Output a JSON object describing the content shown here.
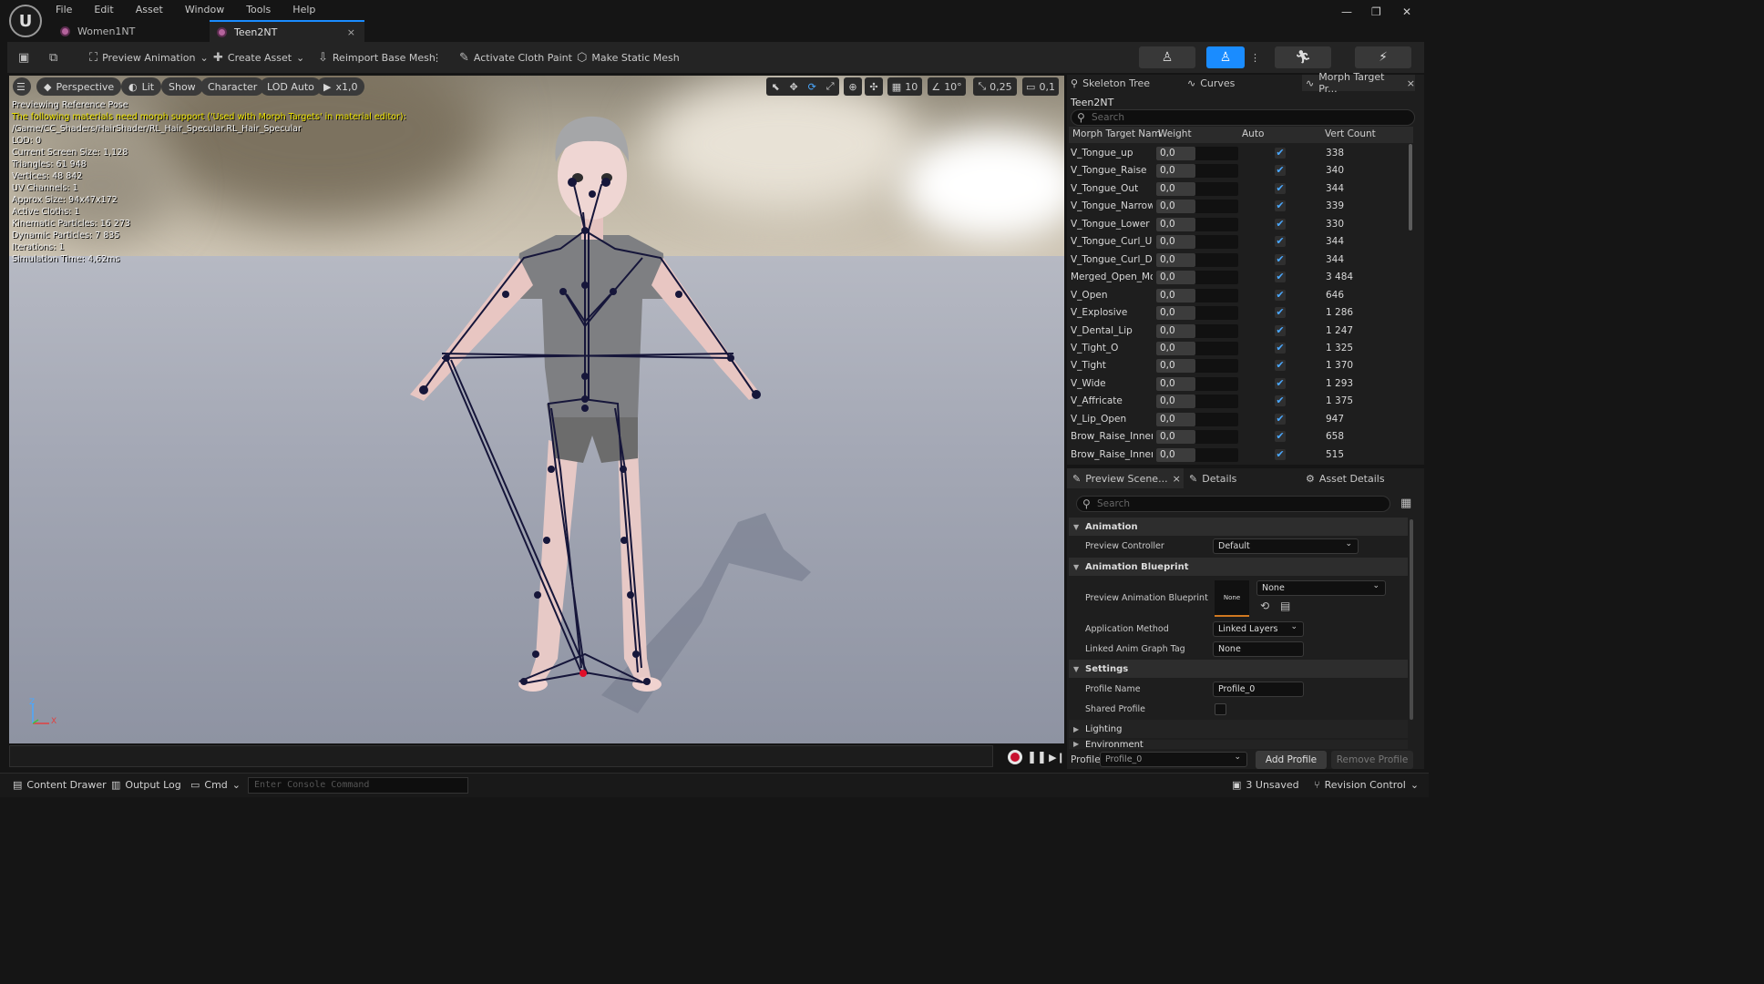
{
  "menu": [
    "File",
    "Edit",
    "Asset",
    "Window",
    "Tools",
    "Help"
  ],
  "window_controls": {
    "minimize": "—",
    "restore": "❐",
    "close": "✕"
  },
  "tabs": [
    {
      "label": "Women1NT"
    },
    {
      "label": "Teen2NT",
      "close": "×"
    }
  ],
  "toolbar": {
    "preview_animation": "Preview Animation",
    "create_asset": "Create Asset",
    "reimport": "Reimport Base Mesh",
    "cloth_paint": "Activate Cloth Paint",
    "static_mesh": "Make Static Mesh"
  },
  "viewport": {
    "perspective": "Perspective",
    "lit": "Lit",
    "show": "Show",
    "character": "Character",
    "lod": "LOD Auto",
    "speed": "x1,0",
    "grid": "10",
    "angle": "10°",
    "scale": "0,25",
    "camera": "0,1",
    "stats": [
      {
        "text": "Previewing Reference Pose",
        "warn": false
      },
      {
        "text": "The following materials need morph support ('Used with Morph Targets' in material editor):",
        "warn": true
      },
      {
        "text": "/Game/CC_Shaders/HairShader/RL_Hair_Specular.RL_Hair_Specular",
        "warn": false
      },
      {
        "text": "LOD: 0",
        "warn": false
      },
      {
        "text": "Current Screen Size: 1,128",
        "warn": false
      },
      {
        "text": "Triangles: 61 948",
        "warn": false
      },
      {
        "text": "Vertices: 48 842",
        "warn": false
      },
      {
        "text": "UV Channels: 1",
        "warn": false
      },
      {
        "text": "Approx Size: 94x47x172",
        "warn": false
      },
      {
        "text": "Active Cloths: 1",
        "warn": false
      },
      {
        "text": "Kinematic Particles: 16 273",
        "warn": false
      },
      {
        "text": "Dynamic Particles: 7 835",
        "warn": false
      },
      {
        "text": "Iterations: 1",
        "warn": false
      },
      {
        "text": "Simulation Time: 4,62ms",
        "warn": false
      }
    ],
    "axis": {
      "z": "Z",
      "x": "X"
    }
  },
  "right_tabs": {
    "skeleton": "Skeleton Tree",
    "curves": "Curves",
    "morph": "Morph Target Pr...",
    "close": "×"
  },
  "morph_panel": {
    "asset": "Teen2NT",
    "search_placeholder": "Search",
    "columns": [
      "Morph Target Nam",
      "Weight",
      "Auto",
      "Vert Count"
    ],
    "rows": [
      {
        "name": "V_Tongue_up",
        "weight": "0,0",
        "auto": true,
        "verts": "338"
      },
      {
        "name": "V_Tongue_Raise",
        "weight": "0,0",
        "auto": true,
        "verts": "340"
      },
      {
        "name": "V_Tongue_Out",
        "weight": "0,0",
        "auto": true,
        "verts": "344"
      },
      {
        "name": "V_Tongue_Narrow",
        "weight": "0,0",
        "auto": true,
        "verts": "339"
      },
      {
        "name": "V_Tongue_Lower",
        "weight": "0,0",
        "auto": true,
        "verts": "330"
      },
      {
        "name": "V_Tongue_Curl_U",
        "weight": "0,0",
        "auto": true,
        "verts": "344"
      },
      {
        "name": "V_Tongue_Curl_D",
        "weight": "0,0",
        "auto": true,
        "verts": "344"
      },
      {
        "name": "Merged_Open_Mout",
        "weight": "0,0",
        "auto": true,
        "verts": "3 484"
      },
      {
        "name": "V_Open",
        "weight": "0,0",
        "auto": true,
        "verts": "646"
      },
      {
        "name": "V_Explosive",
        "weight": "0,0",
        "auto": true,
        "verts": "1 286"
      },
      {
        "name": "V_Dental_Lip",
        "weight": "0,0",
        "auto": true,
        "verts": "1 247"
      },
      {
        "name": "V_Tight_O",
        "weight": "0,0",
        "auto": true,
        "verts": "1 325"
      },
      {
        "name": "V_Tight",
        "weight": "0,0",
        "auto": true,
        "verts": "1 370"
      },
      {
        "name": "V_Wide",
        "weight": "0,0",
        "auto": true,
        "verts": "1 293"
      },
      {
        "name": "V_Affricate",
        "weight": "0,0",
        "auto": true,
        "verts": "1 375"
      },
      {
        "name": "V_Lip_Open",
        "weight": "0,0",
        "auto": true,
        "verts": "947"
      },
      {
        "name": "Brow_Raise_Inner_l",
        "weight": "0,0",
        "auto": true,
        "verts": "658"
      },
      {
        "name": "Brow_Raise_Inner_l",
        "weight": "0,0",
        "auto": true,
        "verts": "515"
      }
    ]
  },
  "details_tabs": {
    "preview": "Preview Scene...",
    "close": "×",
    "details": "Details",
    "asset_details": "Asset Details"
  },
  "details": {
    "search_placeholder": "Search",
    "animation_section": "Animation",
    "preview_controller_label": "Preview Controller",
    "preview_controller_value": "Default",
    "blueprint_section": "Animation Blueprint",
    "preview_bp_label": "Preview Animation Blueprint",
    "preview_bp_thumb": "None",
    "preview_bp_value": "None",
    "app_method_label": "Application Method",
    "app_method_value": "Linked Layers",
    "linked_tag_label": "Linked Anim Graph Tag",
    "linked_tag_value": "None",
    "settings_section": "Settings",
    "profile_name_label": "Profile Name",
    "profile_name_value": "Profile_0",
    "shared_profile_label": "Shared Profile",
    "lighting_section": "Lighting",
    "environment_section": "Environment"
  },
  "profile_bar": {
    "label": "Profile",
    "value": "Profile_0",
    "add": "Add Profile",
    "remove": "Remove Profile"
  },
  "statusbar": {
    "content_drawer": "Content Drawer",
    "output_log": "Output Log",
    "cmd": "Cmd",
    "console_placeholder": "Enter Console Command",
    "unsaved": "3 Unsaved",
    "revision": "Revision Control"
  },
  "colors": {
    "accent": "#1a8cff",
    "warning_text": "#f0e600",
    "bone": "#16163a",
    "red_joint": "#e0102a"
  }
}
